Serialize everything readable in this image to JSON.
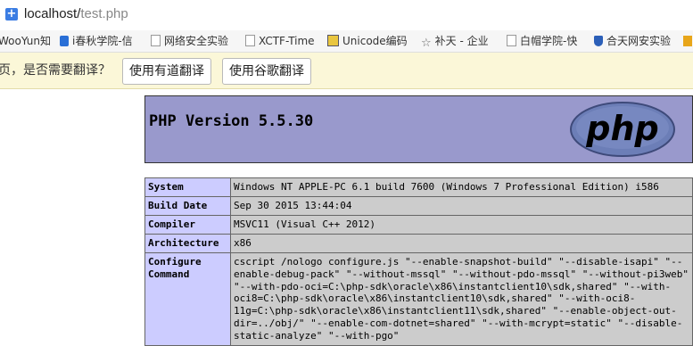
{
  "address": {
    "host": "localhost/",
    "path": "test.php"
  },
  "bookmarks": [
    {
      "label": "WooYun知",
      "icon": "none"
    },
    {
      "label": "i春秋学院-信",
      "icon": "i-icon"
    },
    {
      "label": "网络安全实验",
      "icon": "page-icon"
    },
    {
      "label": "XCTF-Time",
      "icon": "page-icon"
    },
    {
      "label": "Unicode编码",
      "icon": "unicode-icon"
    },
    {
      "label": "补天 - 企业",
      "icon": "star-icon"
    },
    {
      "label": "白帽学院-快",
      "icon": "page-icon"
    },
    {
      "label": "合天网安实验",
      "icon": "shield-icon"
    },
    {
      "label": "",
      "icon": "folder-icon"
    }
  ],
  "translate": {
    "prompt": "页，是否需要翻译？",
    "youdao_label": "使用有道翻译",
    "google_label": "使用谷歌翻译"
  },
  "php": {
    "title": "PHP Version 5.5.30",
    "logo_text": "php",
    "rows": [
      {
        "key": "System",
        "value": "Windows NT APPLE-PC 6.1 build 7600 (Windows 7 Professional Edition) i586"
      },
      {
        "key": "Build Date",
        "value": "Sep 30 2015 13:44:04"
      },
      {
        "key": "Compiler",
        "value": "MSVC11 (Visual C++ 2012)"
      },
      {
        "key": "Architecture",
        "value": "x86"
      },
      {
        "key": "Configure Command",
        "value": "cscript /nologo configure.js \"--enable-snapshot-build\" \"--disable-isapi\" \"--enable-debug-pack\" \"--without-mssql\" \"--without-pdo-mssql\" \"--without-pi3web\" \"--with-pdo-oci=C:\\php-sdk\\oracle\\x86\\instantclient10\\sdk,shared\" \"--with-oci8=C:\\php-sdk\\oracle\\x86\\instantclient10\\sdk,shared\" \"--with-oci8-11g=C:\\php-sdk\\oracle\\x86\\instantclient11\\sdk,shared\" \"--enable-object-out-dir=../obj/\" \"--enable-com-dotnet=shared\" \"--with-mcrypt=static\" \"--disable-static-analyze\" \"--with-pgo\""
      }
    ]
  }
}
